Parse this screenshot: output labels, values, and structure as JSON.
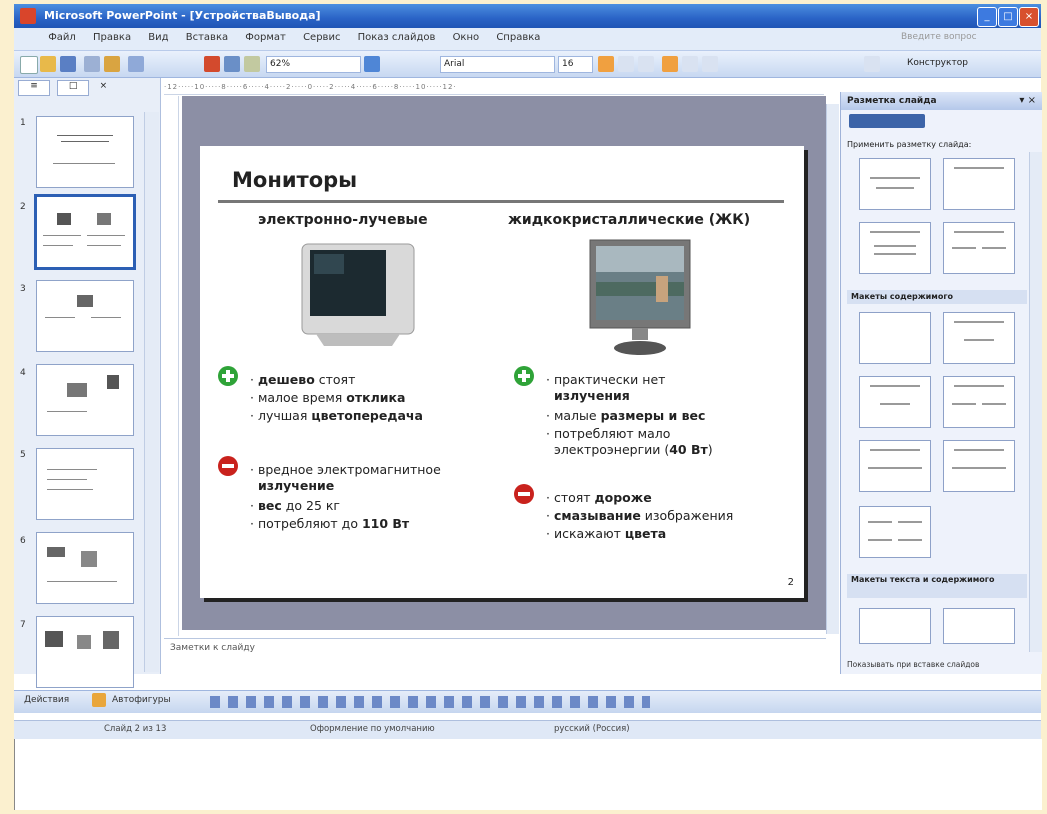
{
  "window": {
    "title": "Microsoft PowerPoint - [УстройстваВывода]"
  },
  "menu": [
    "Файл",
    "Правка",
    "Вид",
    "Вставка",
    "Формат",
    "Сервис",
    "Показ слайдов",
    "Окно",
    "Справка"
  ],
  "help_box": "Введите вопрос",
  "toolbar": {
    "zoom": "62%",
    "font": "Arial",
    "font_size": "16",
    "layout_button": "Конструктор"
  },
  "thumbnails": [
    {
      "num": "1",
      "selected": false
    },
    {
      "num": "2",
      "selected": true
    },
    {
      "num": "3",
      "selected": false
    },
    {
      "num": "4",
      "selected": false
    },
    {
      "num": "5",
      "selected": false
    },
    {
      "num": "6",
      "selected": false
    },
    {
      "num": "7",
      "selected": false
    }
  ],
  "ruler_text": "·12·····10·····8·····6·····4·····2·····0·····2·····4·····6·····8·····10·····12·",
  "slide": {
    "title": "Мониторы",
    "left_head": "электронно-лучевые",
    "right_head": "жидкокристаллические (ЖК)",
    "left_plus": [
      {
        "bold": "дешево",
        "rest": " стоят"
      },
      {
        "bold": "",
        "rest": "малое время ",
        "bold2": "отклика"
      },
      {
        "bold": "",
        "rest": "лучшая ",
        "bold2": "цветопередача"
      }
    ],
    "left_minus": [
      {
        "line1": "вредное электромагнитное",
        "line2": "излучение"
      },
      {
        "bold": "вес",
        "rest": " до 25 кг"
      },
      {
        "rest": "потребляют до ",
        "bold": "110 Вт"
      }
    ],
    "right_plus": [
      {
        "line1": "практически нет",
        "line2": "излучения"
      },
      {
        "rest": "малые ",
        "bold": "размеры и вес"
      },
      {
        "line1": "потребляют мало",
        "line2a": "электроэнергии (",
        "bold": "40 Вт",
        "line2b": ")"
      }
    ],
    "right_minus": [
      {
        "rest": "стоят ",
        "bold": "дороже"
      },
      {
        "bold": "смазывание",
        "rest": " изображения"
      },
      {
        "rest": "искажают ",
        "bold": "цвета"
      }
    ],
    "number": "2"
  },
  "notes_placeholder": "Заметки к слайду",
  "task_pane": {
    "title": "Разметка слайда",
    "apply_label": "Применить разметку слайда:",
    "section_content": "Макеты содержимого",
    "section_text_content": "Макеты текста и содержимого",
    "footer": "Показывать при вставке слайдов"
  },
  "drawbar": {
    "actions": "Действия",
    "autoshapes": "Автофигуры"
  },
  "status": {
    "slide": "Слайд 2 из 13",
    "design": "Оформление по умолчанию",
    "language": "русский (Россия)"
  }
}
